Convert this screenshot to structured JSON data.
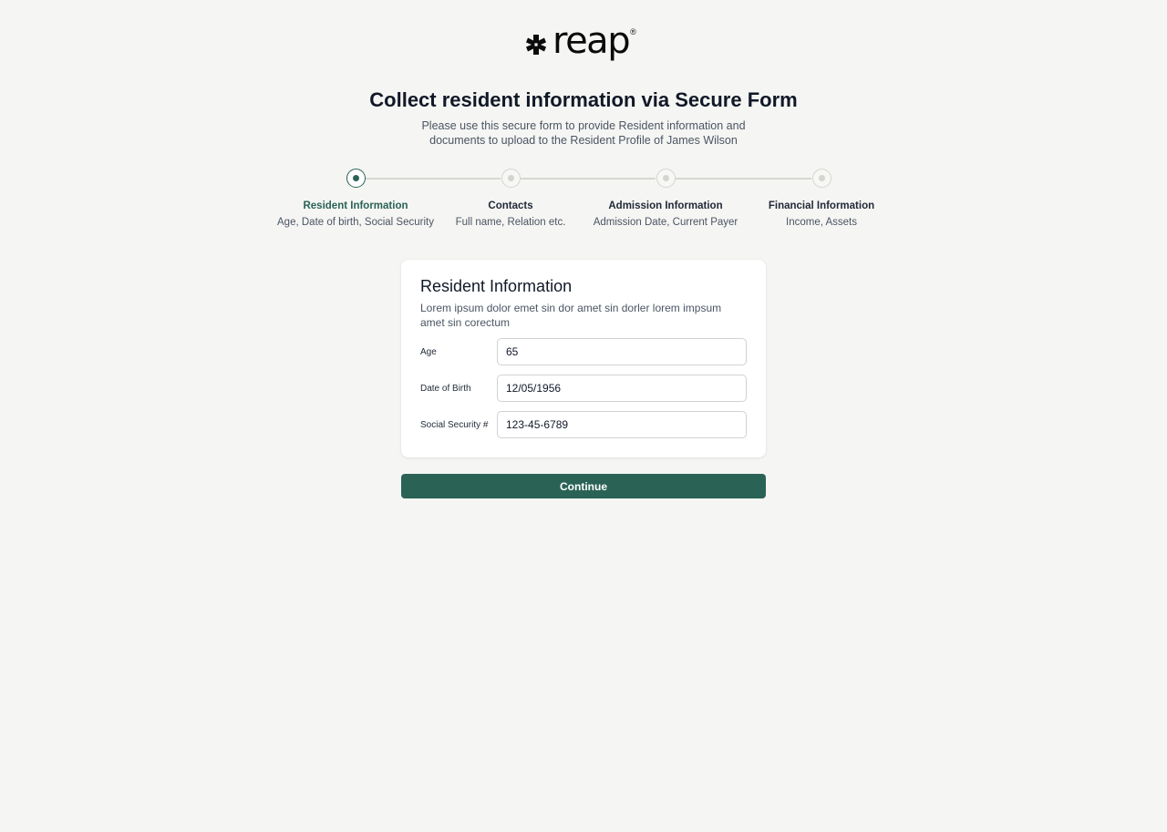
{
  "brand": {
    "name": "reap",
    "registered_mark": "®",
    "logo_icon": "cross-star-logo-icon"
  },
  "header": {
    "title": "Collect resident information via Secure Form",
    "subtitle": "Please use this secure form to provide Resident information and documents to upload to the Resident Profile of James Wilson"
  },
  "steps": [
    {
      "title": "Resident Information",
      "description": "Age, Date of birth, Social Security",
      "state": "active"
    },
    {
      "title": "Contacts",
      "description": "Full name, Relation etc.",
      "state": "upcoming"
    },
    {
      "title": "Admission Information",
      "description": "Admission Date, Current Payer",
      "state": "upcoming"
    },
    {
      "title": "Financial Information",
      "description": "Income, Assets",
      "state": "upcoming"
    }
  ],
  "form": {
    "title": "Resident Information",
    "description": "Lorem ipsum dolor emet sin dor amet sin dorler lorem impsum amet sin corectum",
    "fields": [
      {
        "label": "Age",
        "value": "65"
      },
      {
        "label": "Date of Birth",
        "value": "12/05/1956"
      },
      {
        "label": "Social Security #",
        "value": "123-45-6789"
      }
    ]
  },
  "actions": {
    "continue_label": "Continue"
  },
  "colors": {
    "background": "#f5f5f3",
    "accent": "#2a6356",
    "inactive_step": "#d4d4d0"
  }
}
